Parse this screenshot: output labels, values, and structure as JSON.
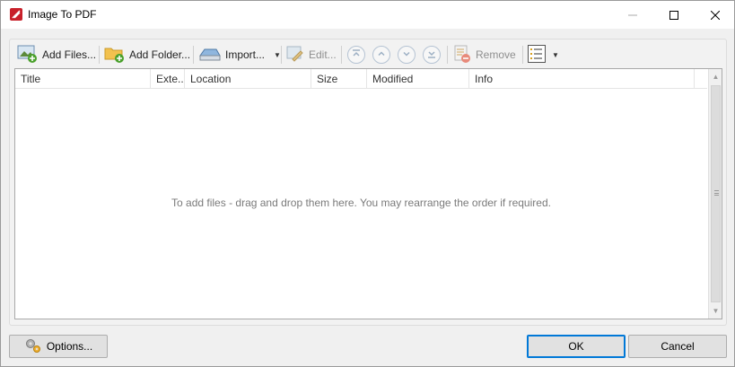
{
  "window": {
    "title": "Image To PDF",
    "controls": {
      "minimize": "minimize",
      "maximize": "maximize",
      "close": "close"
    }
  },
  "toolbar": {
    "add_files": "Add Files...",
    "add_folder": "Add Folder...",
    "import": "Import...",
    "edit": "Edit...",
    "remove": "Remove",
    "icons": [
      "add-image-icon",
      "add-folder-icon",
      "scanner-icon",
      "edit-image-icon",
      "move-top-icon",
      "move-up-icon",
      "move-down-icon",
      "move-bottom-icon",
      "remove-icon",
      "view-options-icon"
    ]
  },
  "list": {
    "columns": [
      "Title",
      "Exte..",
      "Location",
      "Size",
      "Modified",
      "Info"
    ],
    "empty_message": "To add files - drag and drop them here. You may rearrange the order if required."
  },
  "footer": {
    "options_label": "Options...",
    "ok_label": "OK",
    "cancel_label": "Cancel"
  },
  "colors": {
    "accent_border": "#0078d7",
    "window_bg": "#f0f0f0",
    "app_icon_red": "#c8202a"
  }
}
